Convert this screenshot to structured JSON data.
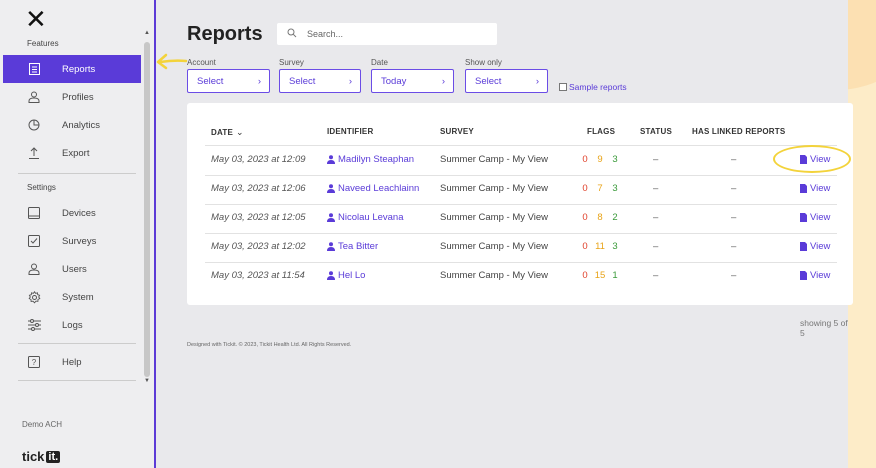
{
  "sidebar": {
    "features_label": "Features",
    "settings_label": "Settings",
    "features": [
      {
        "label": "Reports",
        "icon": "reports-icon"
      },
      {
        "label": "Profiles",
        "icon": "profiles-icon"
      },
      {
        "label": "Analytics",
        "icon": "analytics-icon"
      },
      {
        "label": "Export",
        "icon": "export-icon"
      }
    ],
    "settings": [
      {
        "label": "Devices",
        "icon": "devices-icon"
      },
      {
        "label": "Surveys",
        "icon": "surveys-icon"
      },
      {
        "label": "Users",
        "icon": "users-icon"
      },
      {
        "label": "System",
        "icon": "system-icon"
      },
      {
        "label": "Logs",
        "icon": "logs-icon"
      }
    ],
    "help_label": "Help",
    "account_name": "Demo ACH",
    "logo_text": "tick",
    "logo_badge": "it."
  },
  "main": {
    "title": "Reports",
    "search_placeholder": "Search...",
    "filters": [
      {
        "label": "Account",
        "value": "Select"
      },
      {
        "label": "Survey",
        "value": "Select"
      },
      {
        "label": "Date",
        "value": "Today"
      },
      {
        "label": "Show only",
        "value": "Select"
      }
    ],
    "sample_reports_label": "Sample reports",
    "columns": [
      "DATE",
      "IDENTIFIER",
      "SURVEY",
      "FLAGS",
      "STATUS",
      "HAS LINKED REPORTS"
    ],
    "rows": [
      {
        "date": "May 03, 2023 at 12:09",
        "identifier": "Madilyn Steaphan",
        "survey": "Summer Camp - My View",
        "flag_red": "0",
        "flag_orange": "9",
        "flag_green": "3",
        "status": "–",
        "linked": "–",
        "action": "View"
      },
      {
        "date": "May 03, 2023 at 12:06",
        "identifier": "Naveed Leachlainn",
        "survey": "Summer Camp - My View",
        "flag_red": "0",
        "flag_orange": "7",
        "flag_green": "3",
        "status": "–",
        "linked": "–",
        "action": "View"
      },
      {
        "date": "May 03, 2023 at 12:05",
        "identifier": "Nicolau Levana",
        "survey": "Summer Camp - My View",
        "flag_red": "0",
        "flag_orange": "8",
        "flag_green": "2",
        "status": "–",
        "linked": "–",
        "action": "View"
      },
      {
        "date": "May 03, 2023 at 12:02",
        "identifier": "Tea Bitter",
        "survey": "Summer Camp - My View",
        "flag_red": "0",
        "flag_orange": "11",
        "flag_green": "3",
        "status": "–",
        "linked": "–",
        "action": "View"
      },
      {
        "date": "May 03, 2023 at 11:54",
        "identifier": "Hel Lo",
        "survey": "Summer Camp - My View",
        "flag_red": "0",
        "flag_orange": "15",
        "flag_green": "1",
        "status": "–",
        "linked": "–",
        "action": "View"
      }
    ],
    "showing_text": "showing 5 of 5",
    "footer_text": "Designed with Tickit. © 2023, Tickit Health Ltd. All Rights Reserved."
  },
  "colors": {
    "accent": "#5a3bd8",
    "flag_red": "#e0402a",
    "flag_orange": "#e8a317",
    "flag_green": "#3a9a3a",
    "annotation": "#f3d33b"
  }
}
